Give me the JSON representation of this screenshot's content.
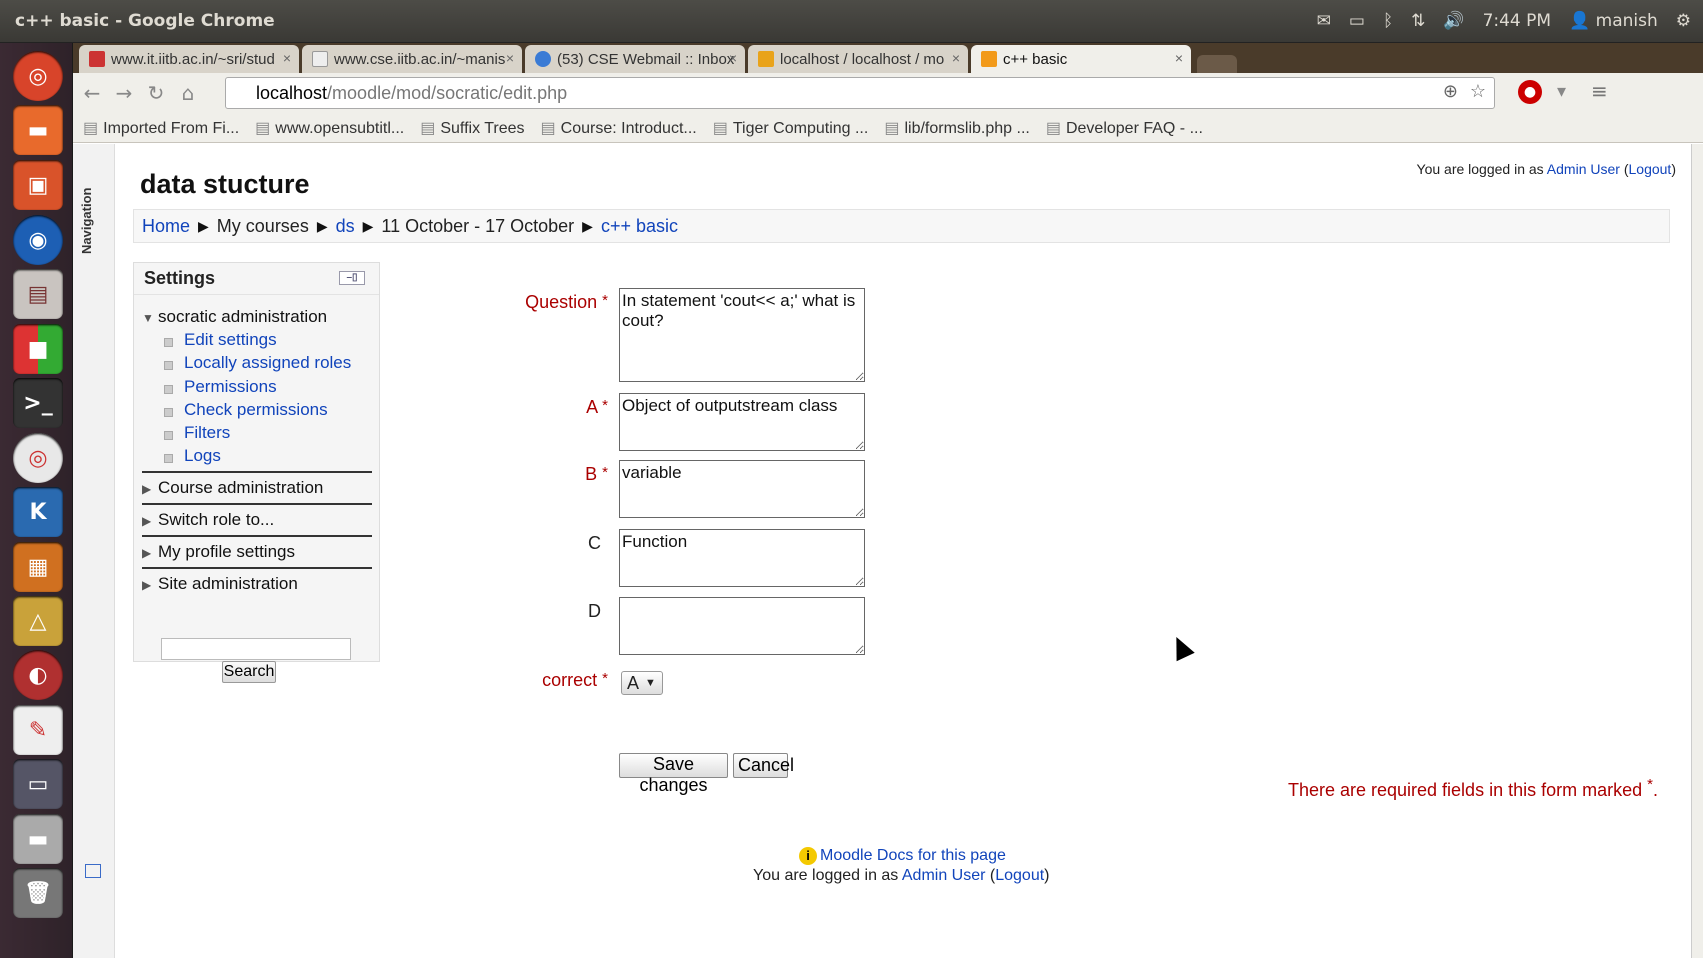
{
  "os": {
    "window_title": "c++ basic - Google Chrome",
    "time": "7:44 PM",
    "user": "manish"
  },
  "browser": {
    "tabs": [
      {
        "label": "www.it.iitb.ac.in/~sri/stud"
      },
      {
        "label": "www.cse.iitb.ac.in/~manis"
      },
      {
        "label": "(53) CSE Webmail :: Inbox"
      },
      {
        "label": "localhost / localhost / mo"
      },
      {
        "label": "c++ basic"
      }
    ],
    "url_host": "localhost",
    "url_path": "/moodle/mod/socratic/edit.php",
    "bookmarks": [
      "Imported From Fi...",
      "www.opensubtitl...",
      "Suffix Trees",
      "Course: Introduct...",
      "Tiger Computing ...",
      "lib/formslib.php ...",
      "Developer FAQ - ..."
    ]
  },
  "page": {
    "navigation_label": "Navigation",
    "course_name": "data stucture",
    "login": {
      "prefix": "You are logged in as",
      "user": "Admin User",
      "logout": "Logout"
    },
    "breadcrumb": [
      "Home",
      "My courses",
      "ds",
      "11 October - 17 October",
      "c++ basic"
    ],
    "settings": {
      "title": "Settings",
      "socratic_admin": "socratic administration",
      "items": [
        "Edit settings",
        "Locally assigned roles",
        "Permissions",
        "Check permissions",
        "Filters",
        "Logs"
      ],
      "sections": [
        "Course administration",
        "Switch role to...",
        "My profile settings",
        "Site administration"
      ],
      "search_button": "Search",
      "search_value": ""
    },
    "form": {
      "question_label": "Question",
      "question_value": "In statement 'cout<< a;' what is cout?",
      "a_label": "A",
      "a_value": "Object of outputstream class",
      "b_label": "B",
      "b_value": "variable",
      "c_label": "C",
      "c_value": "Function",
      "d_label": "D",
      "d_value": "",
      "correct_label": "correct",
      "correct_value": "A",
      "save_label": "Save changes",
      "cancel_label": "Cancel",
      "required_note": "There are required fields in this form marked",
      "required_star": "*"
    },
    "footer": {
      "docs_link": "Moodle Docs for this page",
      "login_prefix": "You are logged in as",
      "login_user": "Admin User",
      "logout": "Logout"
    }
  }
}
